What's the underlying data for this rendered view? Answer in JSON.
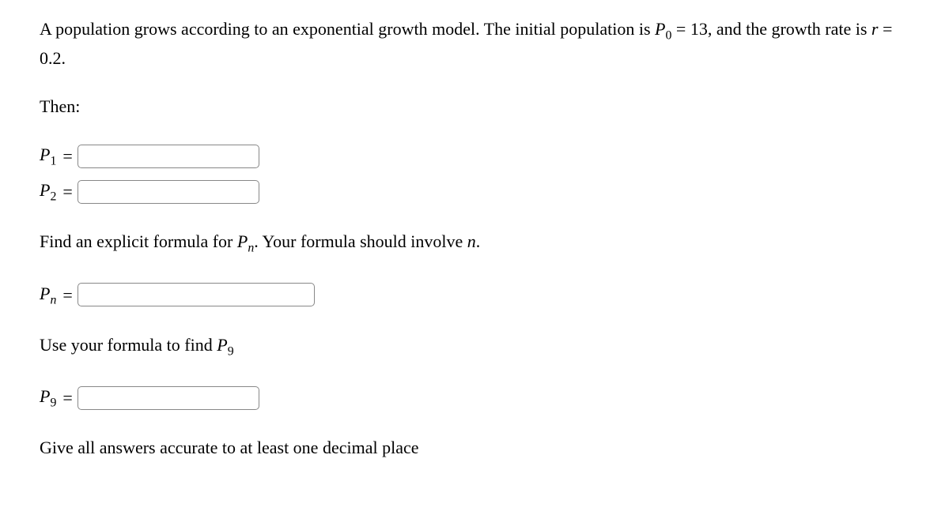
{
  "intro": {
    "part1": "A population grows according to an exponential growth model. The initial population is ",
    "p0_symbol": "P",
    "p0_sub": "0",
    "p0_value": "13",
    "part2": ", and the growth rate is ",
    "r_symbol": "r",
    "r_value": "0.2",
    "period": "."
  },
  "then_label": "Then:",
  "p1": {
    "symbol": "P",
    "sub": "1",
    "value": ""
  },
  "p2": {
    "symbol": "P",
    "sub": "2",
    "value": ""
  },
  "explicit_prompt": {
    "part1": "Find an explicit formula for ",
    "pn_symbol": "P",
    "pn_sub": "n",
    "part2": ". Your formula should involve ",
    "n_symbol": "n",
    "period": "."
  },
  "pn": {
    "symbol": "P",
    "sub": "n",
    "value": ""
  },
  "p9_prompt": {
    "part1": "Use your formula to find ",
    "p9_symbol": "P",
    "p9_sub": "9"
  },
  "p9": {
    "symbol": "P",
    "sub": "9",
    "value": ""
  },
  "footer": "Give all answers accurate to at least one decimal place"
}
